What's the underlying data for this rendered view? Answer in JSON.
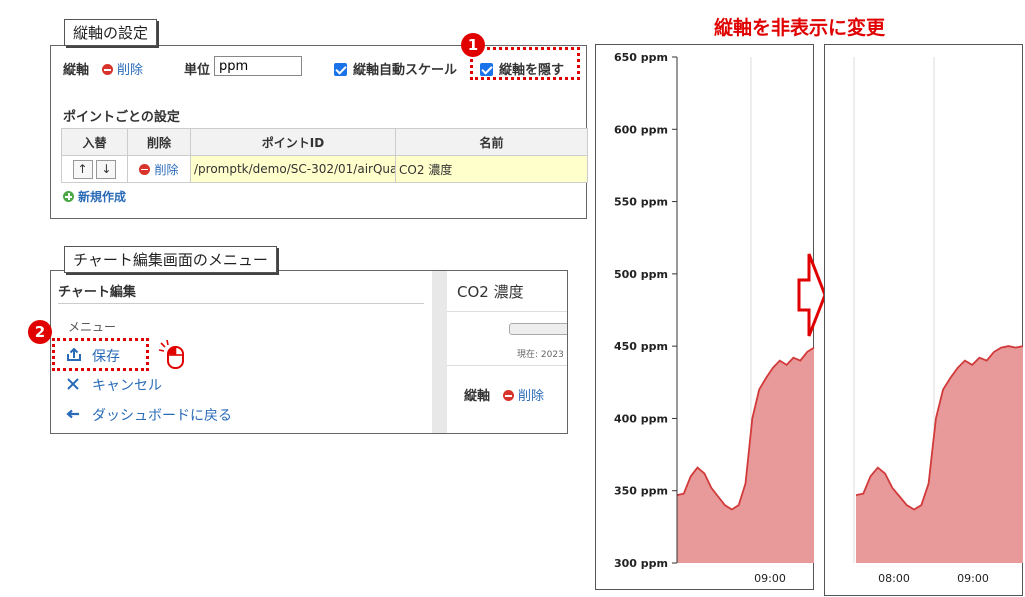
{
  "axis_settings": {
    "caption": "縦軸の設定",
    "axis_label": "縦軸",
    "delete_label": "削除",
    "unit_label": "単位",
    "unit_value": "ppm",
    "auto_scale_label": "縦軸自動スケール",
    "hide_axis_label": "縦軸を隠す",
    "point_settings_title": "ポイントごとの設定",
    "table_headers": [
      "入替",
      "削除",
      "ポイントID",
      "名前"
    ],
    "row": {
      "up": "↑",
      "down": "↓",
      "delete_label": "削除",
      "point_id": "/promptk/demo/SC-302/01/airQua",
      "name": "CO2 濃度"
    },
    "new_label": "新規作成"
  },
  "menu_section": {
    "caption": "チャート編集画面のメニュー",
    "title": "チャート編集",
    "menu_label": "メニュー",
    "save_label": "保存",
    "cancel_label": "キャンセル",
    "back_label": "ダッシュボードに戻る",
    "preview_title": "CO2 濃度",
    "preview_now": "現在: 2023",
    "preview_axis_label": "縦軸",
    "preview_delete_label": "削除"
  },
  "badges": {
    "step1": "1",
    "step2": "2"
  },
  "change_title": "縦軸を非表示に変更",
  "colors": {
    "accent_red": "#e00000",
    "link_blue": "#2a6bb8",
    "area_fill": "#e8999a",
    "area_line": "#d23a3a"
  },
  "chart_data": [
    {
      "type": "area",
      "y_tick_labels": [
        "650 ppm",
        "600 ppm",
        "550 ppm",
        "500 ppm",
        "450 ppm",
        "400 ppm",
        "350 ppm",
        "300 ppm"
      ],
      "x_tick_labels": [
        "09:00"
      ],
      "ylim": [
        300,
        650
      ],
      "y_axis_visible": true,
      "series": [
        {
          "values": [
            347,
            348,
            360,
            366,
            362,
            352,
            346,
            340,
            337,
            340,
            355,
            400,
            420,
            428,
            435,
            440,
            437,
            442,
            440,
            446,
            449
          ]
        }
      ]
    },
    {
      "type": "area",
      "x_tick_labels": [
        "08:00",
        "09:00"
      ],
      "ylim": [
        300,
        650
      ],
      "y_axis_visible": false,
      "series": [
        {
          "values": [
            347,
            348,
            360,
            366,
            362,
            352,
            346,
            340,
            337,
            340,
            355,
            400,
            420,
            428,
            435,
            440,
            437,
            442,
            440,
            446,
            449,
            450,
            449,
            450
          ]
        }
      ]
    }
  ]
}
